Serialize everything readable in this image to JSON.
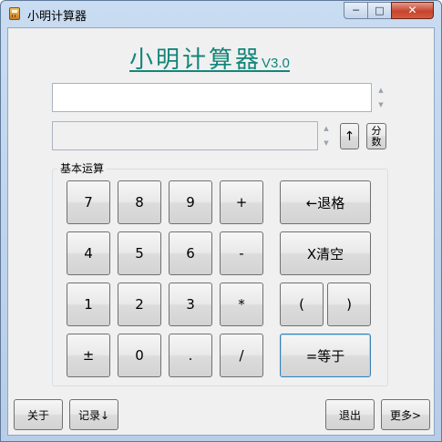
{
  "window": {
    "title": "小明计算器",
    "controls": {
      "minimize": "─",
      "maximize": "□",
      "close": "✕"
    }
  },
  "header": {
    "title": "小明计算器",
    "version": "V3.0"
  },
  "display": {
    "expression": "",
    "result": "",
    "spin_up": "▲",
    "spin_down": "▼"
  },
  "side_buttons": {
    "up_label": "↑",
    "fraction_top": "分",
    "fraction_bottom": "数"
  },
  "keypad": {
    "group_title": "基本运算",
    "keys": {
      "seven": "7",
      "eight": "8",
      "nine": "9",
      "plus": "+",
      "four": "4",
      "five": "5",
      "six": "6",
      "minus": "-",
      "one": "1",
      "two": "2",
      "three": "3",
      "multiply": "*",
      "plusminus": "±",
      "zero": "0",
      "dot": ".",
      "divide": "/",
      "backspace": "←退格",
      "clear": "X清空",
      "lparen": "(",
      "rparen": ")",
      "equals": "=等于"
    }
  },
  "footer": {
    "about": "关于",
    "record": "记录↓",
    "exit": "退出",
    "more": "更多>"
  }
}
